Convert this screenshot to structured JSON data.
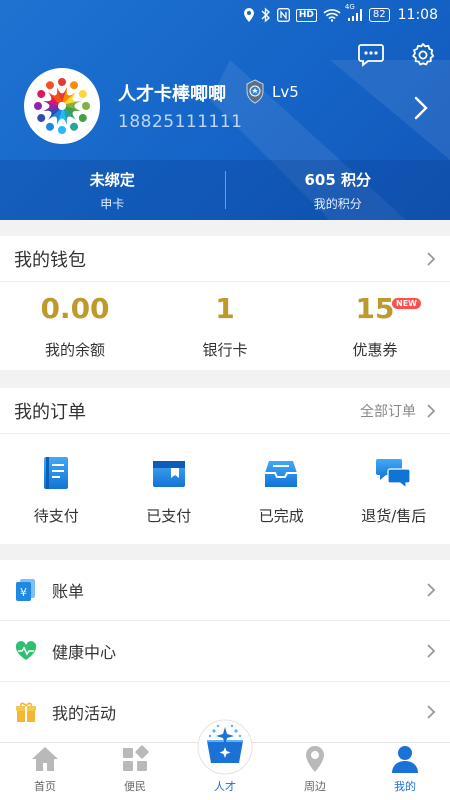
{
  "status_bar": {
    "network": "4G",
    "hd": "HD",
    "battery": "82",
    "time": "11:08"
  },
  "profile": {
    "name": "人才卡棒唧唧",
    "level": "Lv5",
    "phone": "18825111111"
  },
  "stats": [
    {
      "value": "未绑定",
      "label": "申卡"
    },
    {
      "value": "605 积分",
      "label": "我的积分"
    }
  ],
  "wallet": {
    "title": "我的钱包",
    "items": [
      {
        "value": "0.00",
        "label": "我的余额"
      },
      {
        "value": "1",
        "label": "银行卡"
      },
      {
        "value": "15",
        "label": "优惠券",
        "badge": "NEW"
      }
    ]
  },
  "orders": {
    "title": "我的订单",
    "more": "全部订单",
    "items": [
      {
        "label": "待支付",
        "icon": "pending-payment-icon"
      },
      {
        "label": "已支付",
        "icon": "paid-icon"
      },
      {
        "label": "已完成",
        "icon": "completed-icon"
      },
      {
        "label": "退货/售后",
        "icon": "after-sales-icon"
      }
    ]
  },
  "menu": [
    {
      "label": "账单",
      "icon": "bill-icon"
    },
    {
      "label": "健康中心",
      "icon": "heart-pulse-icon"
    },
    {
      "label": "我的活动",
      "icon": "gift-icon"
    }
  ],
  "nav": [
    {
      "label": "首页",
      "icon": "home-icon"
    },
    {
      "label": "便民",
      "icon": "apps-icon"
    },
    {
      "label": "人才",
      "icon": "talent-icon"
    },
    {
      "label": "周边",
      "icon": "location-icon"
    },
    {
      "label": "我的",
      "icon": "user-icon"
    }
  ],
  "colors": {
    "header": "#1a6bd0",
    "accent": "#1a72d6",
    "gold": "#bd9a2b",
    "badge": "#ff4f4f"
  }
}
